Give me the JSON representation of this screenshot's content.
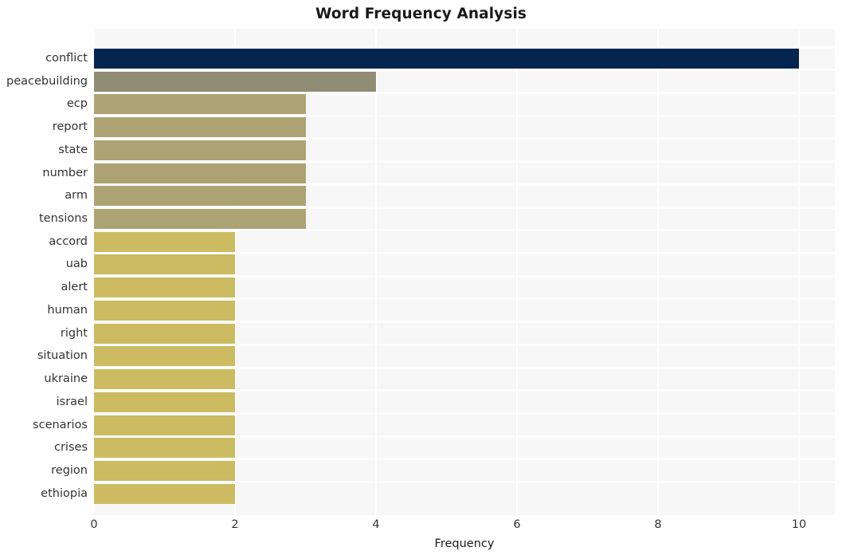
{
  "chart_data": {
    "type": "bar",
    "orientation": "horizontal",
    "title": "Word Frequency Analysis",
    "xlabel": "Frequency",
    "ylabel": "",
    "xlim": [
      0,
      10.5
    ],
    "xticks": [
      "0",
      "2",
      "4",
      "6",
      "8",
      "10"
    ],
    "xtick_values": [
      0,
      2,
      4,
      6,
      8,
      10
    ],
    "grid": true,
    "legend": "none",
    "categories": [
      "conflict",
      "peacebuilding",
      "ecp",
      "report",
      "state",
      "number",
      "arm",
      "tensions",
      "accord",
      "uab",
      "alert",
      "human",
      "right",
      "situation",
      "ukraine",
      "israel",
      "scenarios",
      "crises",
      "region",
      "ethiopia"
    ],
    "values": [
      10,
      4,
      3,
      3,
      3,
      3,
      3,
      3,
      2,
      2,
      2,
      2,
      2,
      2,
      2,
      2,
      2,
      2,
      2,
      2
    ],
    "bar_colors": [
      "#04254f",
      "#918c74",
      "#ada273",
      "#ada273",
      "#ada273",
      "#ada273",
      "#ada273",
      "#ada273",
      "#ccbb60",
      "#ccbb60",
      "#ccbb60",
      "#ccbb60",
      "#ccbb60",
      "#ccbb60",
      "#ccbb60",
      "#ccbb60",
      "#ccbb60",
      "#ccbb60",
      "#ccbb60",
      "#ccbb60"
    ]
  },
  "style": {
    "figure_background": "#ffffff",
    "plot_background": "#f7f7f8",
    "gridline_color": "#ffffff",
    "title_color": "#1a1a1a",
    "tick_label_color": "#333333"
  }
}
